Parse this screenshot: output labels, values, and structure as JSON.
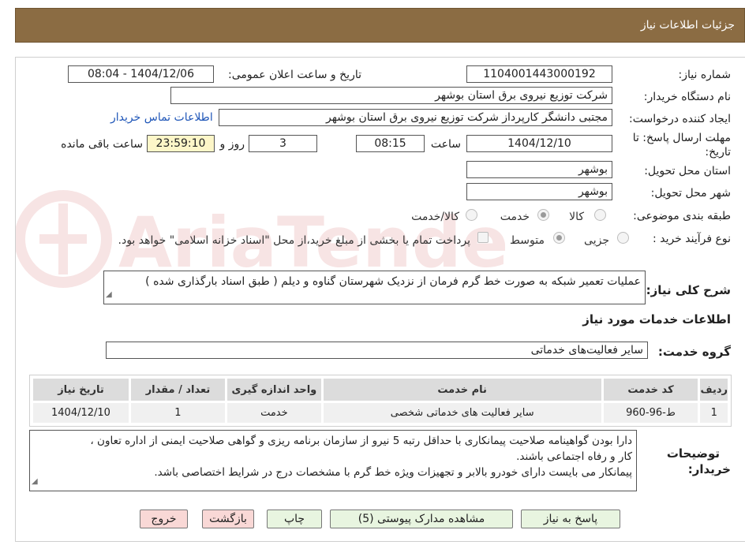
{
  "header": {
    "title": "جزئیات اطلاعات نیاز"
  },
  "form": {
    "need_number_label": "شماره نیاز:",
    "need_number": "1104001443000192",
    "announce_label": "تاریخ و ساعت اعلان عمومی:",
    "announce_value": "1404/12/06 - 08:04",
    "buyer_label": "نام دستگاه خریدار:",
    "buyer_value": "شرکت توزیع نیروی برق استان بوشهر",
    "creator_label": "ایجاد کننده درخواست:",
    "creator_value": "مجتبی دانشگر کارپرداز شرکت توزیع نیروی برق استان بوشهر",
    "contact_link": "اطلاعات تماس خریدار",
    "deadline_label_1": "مهلت ارسال پاسخ: تا",
    "deadline_label_2": "تاریخ:",
    "deadline_date": "1404/12/10",
    "time_label": "ساعت",
    "deadline_time": "08:15",
    "days_value": "3",
    "days_label": "روز و",
    "remaining_time": "23:59:10",
    "remaining_label": "ساعت باقی مانده",
    "province_label": "استان محل تحویل:",
    "province_value": "بوشهر",
    "city_label": "شهر محل تحویل:",
    "city_value": "بوشهر",
    "category_label": "طبقه بندی موضوعی:",
    "category_options": [
      "کالا",
      "خدمت",
      "کالا/خدمت"
    ],
    "category_selected": "خدمت",
    "process_label": "نوع فرآیند خرید :",
    "process_options": [
      "جزیی",
      "متوسط"
    ],
    "process_selected": "متوسط",
    "payment_note": "پرداخت تمام یا بخشی از مبلغ خرید،از محل \"اسناد خزانه اسلامی\" خواهد بود.",
    "summary_label": "شرح کلی نیاز:",
    "summary_value": "عملیات تعمیر شبکه به صورت خط گرم فرمان از نزدیک شهرستان گناوه و دیلم ( طبق اسناد بارگذاری شده )",
    "services_heading": "اطلاعات خدمات مورد نیاز",
    "service_group_label": "گروه خدمت:",
    "service_group_value": "سایر فعالیت‌های خدماتی"
  },
  "table": {
    "headers": [
      "ردیف",
      "کد خدمت",
      "نام خدمت",
      "واحد اندازه گیری",
      "تعداد / مقدار",
      "تاریخ نیاز"
    ],
    "rows": [
      [
        "1",
        "ط-96-960",
        "سایر فعالیت های خدماتی شخصی",
        "خدمت",
        "1",
        "1404/12/10"
      ]
    ]
  },
  "notes": {
    "label_1": "توضیحات",
    "label_2": "خریدار:",
    "line_1": "دارا بودن گواهینامه صلاحیت پیمانکاری با حداقل رتبه 5 نیرو از سازمان برنامه ریزی و گواهی صلاحیت ایمنی از اداره تعاون ،",
    "line_2": "کار و رفاه اجتماعی باشند.",
    "line_3": "پیمانکار می بایست دارای خودرو بالابر و تجهیزات ویژه خط گرم با مشخصات درج در شرایط اختصاصی باشد."
  },
  "buttons": {
    "reply": "پاسخ به نیاز",
    "attachments": "مشاهده مدارک پیوستی (5)",
    "print": "چاپ",
    "back": "بازگشت",
    "exit": "خروج"
  },
  "colors": {
    "header_bg": "#8b6c43",
    "button_green": "#e8f5e0",
    "button_pink": "#f9d8d6",
    "link": "#1f56b8"
  },
  "watermark_text": "AriaTender.neT"
}
